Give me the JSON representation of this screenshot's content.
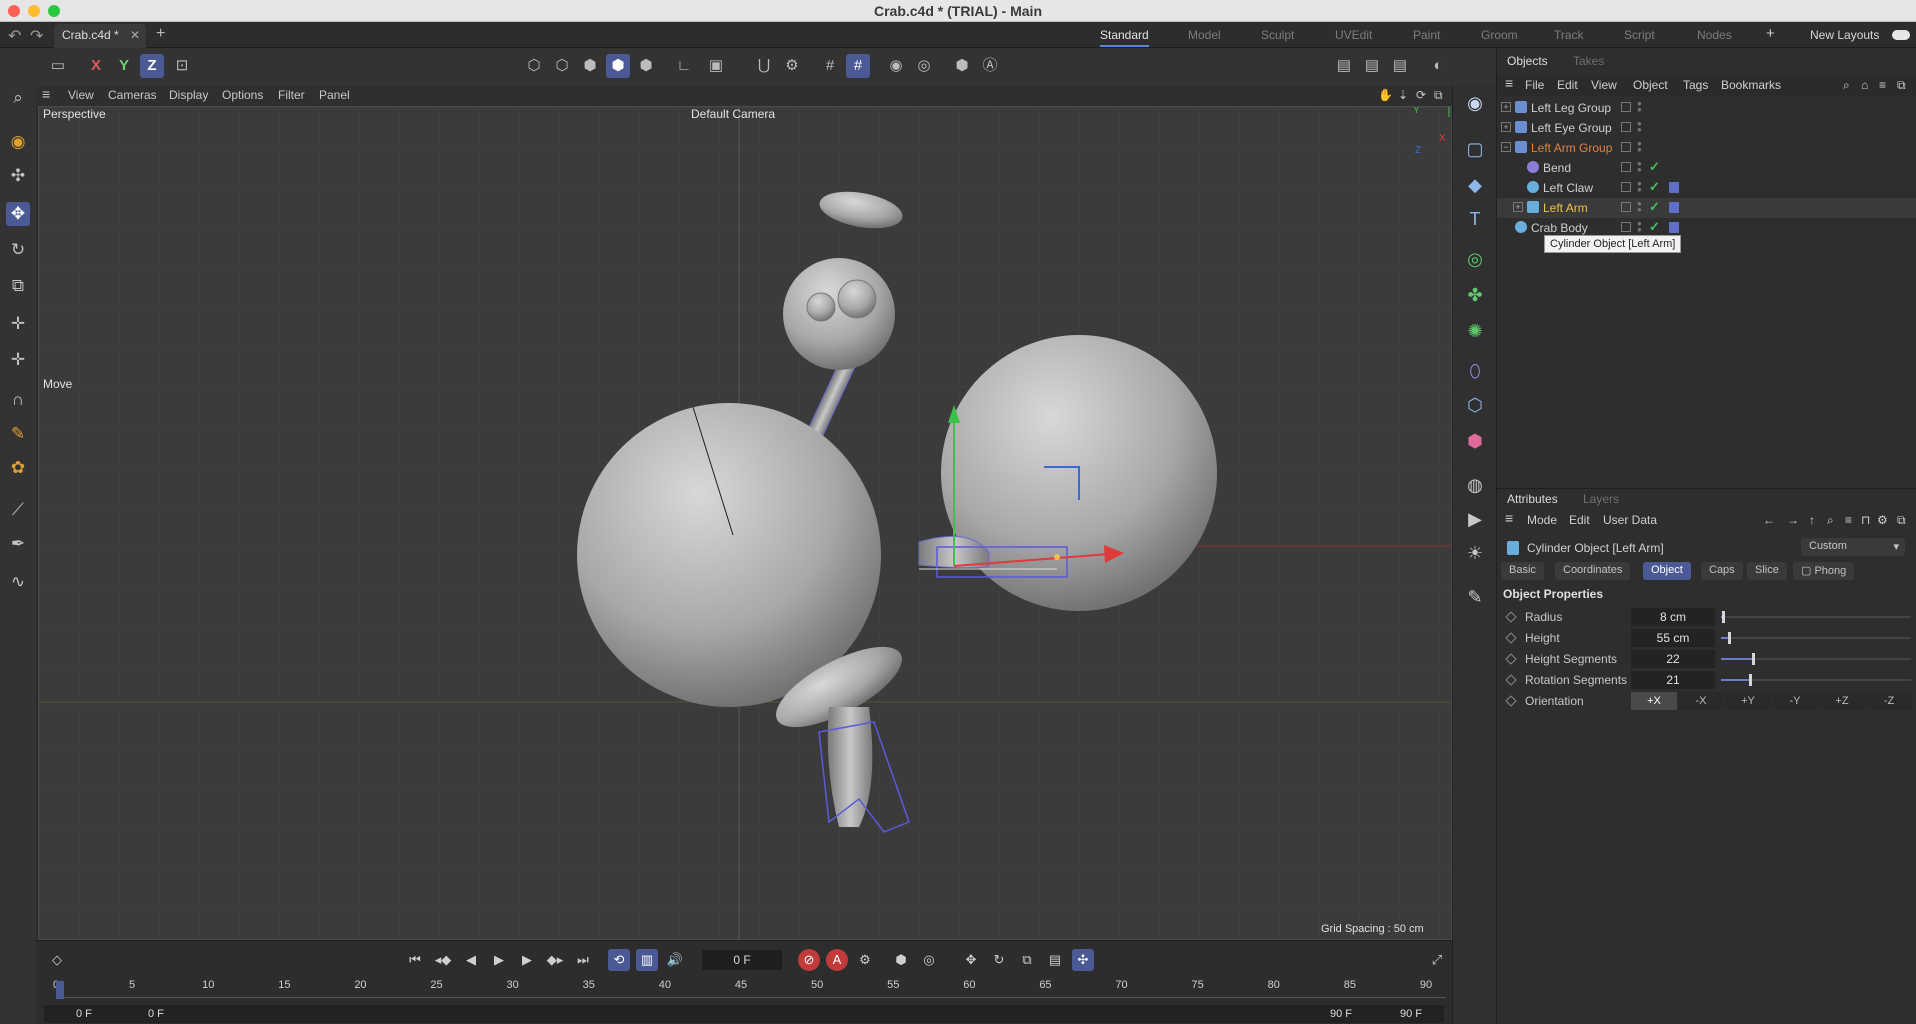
{
  "window": {
    "title": "Crab.c4d * (TRIAL) - Main"
  },
  "tabs": {
    "document": "Crab.c4d *"
  },
  "layouts": {
    "items": [
      "Standard",
      "Model",
      "Sculpt",
      "UVEdit",
      "Paint",
      "Groom",
      "Track",
      "Script",
      "Nodes"
    ],
    "new_layouts": "New Layouts"
  },
  "toolbar": {
    "axis_x": "X",
    "axis_y": "Y",
    "axis_z": "Z"
  },
  "viewport_menu": [
    "View",
    "Cameras",
    "Display",
    "Options",
    "Filter",
    "Panel"
  ],
  "viewport": {
    "view_name": "Perspective",
    "camera": "Default Camera",
    "tool": "Move",
    "grid_spacing": "Grid Spacing : 50 cm",
    "axis_y": "Y",
    "axis_x": "X",
    "axis_z": "Z"
  },
  "objects_panel": {
    "tabs": [
      "Objects",
      "Takes"
    ],
    "menu": [
      "File",
      "Edit",
      "View",
      "Object",
      "Tags",
      "Bookmarks"
    ],
    "rows": [
      {
        "name": "Left Leg Group"
      },
      {
        "name": "Left Eye Group"
      },
      {
        "name": "Left Arm Group"
      },
      {
        "name": "Bend"
      },
      {
        "name": "Left Claw"
      },
      {
        "name": "Left Arm"
      },
      {
        "name": "Crab Body"
      }
    ],
    "tooltip": "Cylinder Object [Left Arm]"
  },
  "attributes_panel": {
    "tabs": [
      "Attributes",
      "Layers"
    ],
    "menu": [
      "Mode",
      "Edit",
      "User Data"
    ],
    "object_title": "Cylinder Object [Left Arm]",
    "preset": "Custom",
    "property_tabs": [
      "Basic",
      "Coordinates",
      "Object",
      "Caps",
      "Slice",
      "Phong"
    ],
    "section": "Object Properties",
    "properties": [
      {
        "label": "Radius",
        "value": "8 cm",
        "level": 0.01
      },
      {
        "label": "Height",
        "value": "55 cm",
        "level": 0.04
      },
      {
        "label": "Height Segments",
        "value": "22",
        "level": 0.17
      },
      {
        "label": "Rotation Segments",
        "value": "21",
        "level": 0.15
      }
    ],
    "orientation": {
      "label": "Orientation",
      "options": [
        "+X",
        "-X",
        "+Y",
        "-Y",
        "+Z",
        "-Z"
      ],
      "selected": "+X"
    }
  },
  "timeline": {
    "current_frame": "0 F",
    "ticks": [
      "0",
      "5",
      "10",
      "15",
      "20",
      "25",
      "30",
      "35",
      "40",
      "45",
      "50",
      "55",
      "60",
      "65",
      "70",
      "75",
      "80",
      "85",
      "90"
    ],
    "range_start": "0 F",
    "range_start2": "0 F",
    "range_end": "90 F",
    "range_end2": "90 F"
  },
  "colors": {
    "accent": "#4b5a94",
    "selected_object": "#f0c04a",
    "group_highlight": "#e0823f",
    "check": "#3fc25b"
  }
}
